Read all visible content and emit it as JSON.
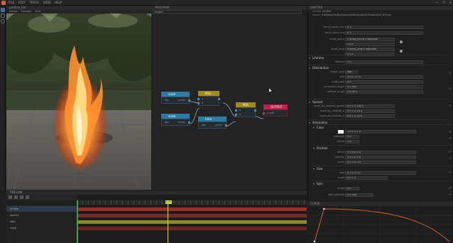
{
  "titlebar": {
    "menu": [
      "FILE",
      "EDIT",
      "TRACK",
      "VIEW",
      "HELP"
    ],
    "buttons": [
      "—",
      "❐",
      "✕"
    ]
  },
  "viewport": {
    "tab": "particle_fire",
    "toolbar": [
      "Active",
      "Camera",
      "Grid"
    ]
  },
  "graph": {
    "tab": "PROGRAM",
    "breadcrumb": "Spawn",
    "nodes": [
      {
        "title": "scale",
        "kind": "scalar",
        "ports": [
          "lbp",
          "cyclar"
        ]
      },
      {
        "title": "MUL",
        "kind": "op",
        "ports": [
          "a",
          "b"
        ]
      },
      {
        "title": "scale",
        "kind": "scalar",
        "ports": [
          "lbp",
          "cyclar"
        ]
      },
      {
        "title": "time",
        "kind": "scalar",
        "ports": [
          "lbp",
          "cyclar"
        ]
      },
      {
        "title": "MUL",
        "kind": "op",
        "ports": [
          "a",
          "b"
        ]
      },
      {
        "title": "OUTPUT",
        "kind": "output",
        "ports": [
          "cyclar"
        ]
      }
    ]
  },
  "timeline": {
    "tab": "TIMELINE",
    "tracks": [
      "emitter",
      "opacity",
      "light",
      "scale"
    ],
    "playhead": "0:12"
  },
  "inspector": {
    "tab": "EMITTER",
    "meta": [
      {
        "label": "emitter",
        "value": "emitter"
      },
      {
        "label": "source",
        "value": "/content/vfx/fire/source/effects/particles/particle_fire.vfx"
      }
    ],
    "top_rows": [
      {
        "label": "burst_count_min",
        "value": "0.1"
      },
      {
        "label": "burst_time_min",
        "value": "0.1"
      },
      {
        "label": "burst_count",
        "value": "5   burst_count   5 seconds"
      },
      {
        "label": "",
        "value": "0   0.1"
      },
      {
        "label": "burst_time",
        "value": "0   burst_time   5 seconds"
      },
      {
        "label": "",
        "value": "0   0.1"
      }
    ],
    "sections": [
      {
        "title": "Lifetime",
        "rows": [
          {
            "label": "lifetime",
            "value": "2.0"
          }
        ]
      },
      {
        "title": "Distribution",
        "rows": [
          {
            "label": "shape_type",
            "value": "box"
          },
          {
            "label": "size",
            "value": "0.0    0.1    0.0"
          },
          {
            "label": "inner_size",
            "value": "0.0"
          },
          {
            "label": "horizontal_angle",
            "value": "0.0    360"
          },
          {
            "label": "vertical_angle",
            "value": "0.0    90.0"
          }
        ]
      },
      {
        "title": "Spread",
        "rows": [
          {
            "label": "scale_by_velocity_speed",
            "value": "0.0    1.0    100.0"
          },
          {
            "label": "scale_by_velocity_x",
            "value": "0.0    1.0    10.0"
          },
          {
            "label": "scale_by_velocity_y",
            "value": "0.0    1.0    10.0"
          }
        ]
      },
      {
        "title": "Simulation",
        "rows": []
      },
      {
        "title": "Color",
        "rows": [
          {
            "label": "rgb",
            "value": "1.0    1.0    1.0"
          },
          {
            "label": "intensity",
            "value": "0.0"
          },
          {
            "label": "alpha",
            "value": "1.0"
          }
        ]
      },
      {
        "title": "Position",
        "rows": [
          {
            "label": "offset",
            "value": "0.0    0.0    0.0"
          },
          {
            "label": "velocity",
            "value": "0.0    2.0    0.0"
          },
          {
            "label": "accel",
            "value": "0.0    1.0    0.0"
          }
        ]
      },
      {
        "title": "Size",
        "rows": [
          {
            "label": "size",
            "value": "0.2    0.3    0.2"
          },
          {
            "label": "scale",
            "value": "0.0    1.0"
          }
        ]
      },
      {
        "title": "Spin",
        "rows": [
          {
            "label": "angle",
            "value": "0.0"
          },
          {
            "label": "spin_velocity",
            "value": "0.0    180"
          }
        ]
      }
    ]
  },
  "curve": {
    "tab": "CURVE",
    "points": [
      [
        0,
        0.0
      ],
      [
        0.07,
        1.0
      ],
      [
        1.0,
        0.0
      ]
    ]
  },
  "colors": {
    "node_scalar": "#2a7ba6",
    "node_op": "#a38a1c",
    "node_output": "#c41e4b",
    "track_emitter": "#9a2e2a",
    "track_light": "#8a8a24",
    "curve": "#d8602a"
  }
}
